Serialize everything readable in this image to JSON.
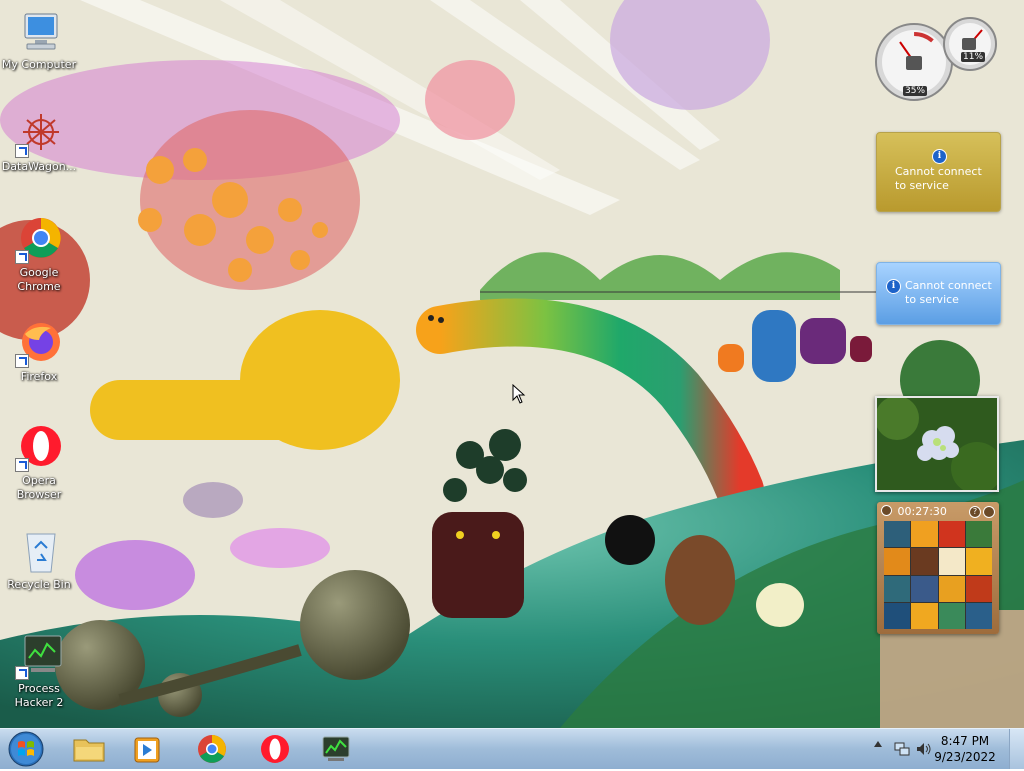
{
  "desktop": {
    "icons": [
      {
        "label": "My Computer",
        "icon": "computer-icon"
      },
      {
        "label": "DataWagon...",
        "icon": "datawagon-icon"
      },
      {
        "label": "Google Chrome",
        "icon": "chrome-icon"
      },
      {
        "label": "Firefox",
        "icon": "firefox-icon"
      },
      {
        "label": "Opera Browser",
        "icon": "opera-icon"
      },
      {
        "label": "Recycle Bin",
        "icon": "recycle-bin-icon"
      },
      {
        "label": "Process Hacker 2",
        "icon": "process-hacker-icon"
      }
    ]
  },
  "gadgets": {
    "cpu_meter": {
      "cpu": "35%",
      "memory": "11%"
    },
    "weather": {
      "message": "Cannot connect to service"
    },
    "currency": {
      "message": "Cannot connect to service"
    },
    "puzzle": {
      "timer": "00:27:30"
    }
  },
  "taskbar": {
    "start_icon": "windows-start-icon",
    "pinned": [
      {
        "name": "file-explorer-icon"
      },
      {
        "name": "media-player-icon"
      },
      {
        "name": "chrome-icon"
      },
      {
        "name": "opera-icon"
      },
      {
        "name": "process-hacker-icon"
      }
    ],
    "clock": {
      "time": "8:47 PM",
      "date": "9/23/2022"
    }
  },
  "colors": {
    "taskbar": "#9fbcd9",
    "weather_gadget": "#c8ad45",
    "currency_gadget": "#7ab8f5"
  }
}
